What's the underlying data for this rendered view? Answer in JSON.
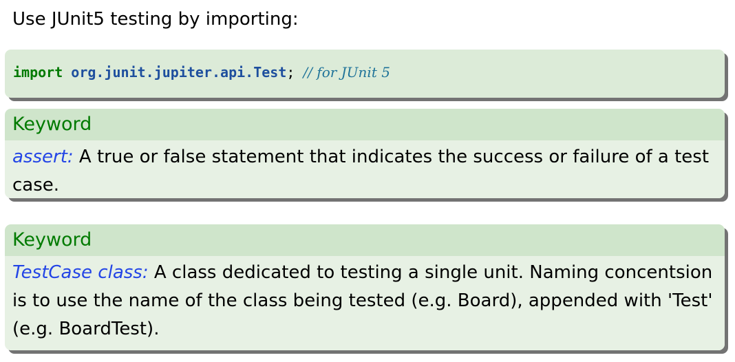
{
  "intro": {
    "text": "Use JUnit5 testing by importing:"
  },
  "code": {
    "keyword": "import",
    "package": "org.junit.jupiter.api.Test",
    "semicolon": ";",
    "comment": "// for JUnit 5"
  },
  "keywords": [
    {
      "title": "Keyword",
      "term": "assert:",
      "definition": " A true or false statement that indicates the success or failure of a test case."
    },
    {
      "title": "Keyword",
      "term": "TestCase class:",
      "definition": " A class dedicated to testing a single unit. Naming concentsion is to use the name of the class being tested (e.g. Board), appended with 'Test' (e.g. BoardTest)."
    }
  ],
  "colors": {
    "keyword_title": "#007a00",
    "term": "#2345e6",
    "code_box_bg": "#dcebd8",
    "box_head_bg": "#cfe5cb",
    "box_body_bg": "#e7f1e4"
  }
}
